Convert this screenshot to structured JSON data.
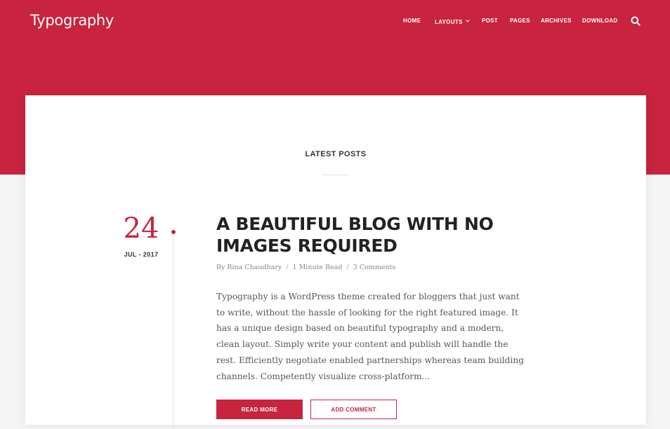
{
  "site": {
    "logo": "Typography"
  },
  "nav": {
    "items": [
      "HOME",
      "LAYOUTS",
      "POST",
      "PAGES",
      "ARCHIVES",
      "DOWNLOAD"
    ],
    "search_icon": "search-icon",
    "dropdown_icon": "chevron-down-icon"
  },
  "section": {
    "title": "LATEST POSTS"
  },
  "post": {
    "day": "24",
    "month_year": "JUL - 2017",
    "title": "A BEAUTIFUL BLOG WITH NO IMAGES REQUIRED",
    "author": "By Rina Chaudhary",
    "read_time": "1 Minute Read",
    "comments": "3 Comments",
    "excerpt": "Typography is a WordPress theme created for bloggers that just want to write, without the hassle of looking for the right featured image. It has a unique design based on beautiful typography and a modern, clean layout. Simply write your content and publish will handle the rest. Efficiently negotiate enabled partnerships whereas team building channels. Competently visualize cross-platform...",
    "read_more": "READ MORE",
    "add_comment": "ADD COMMENT"
  },
  "colors": {
    "accent": "#c8233f",
    "background": "#f5f5f5",
    "card": "#ffffff"
  }
}
